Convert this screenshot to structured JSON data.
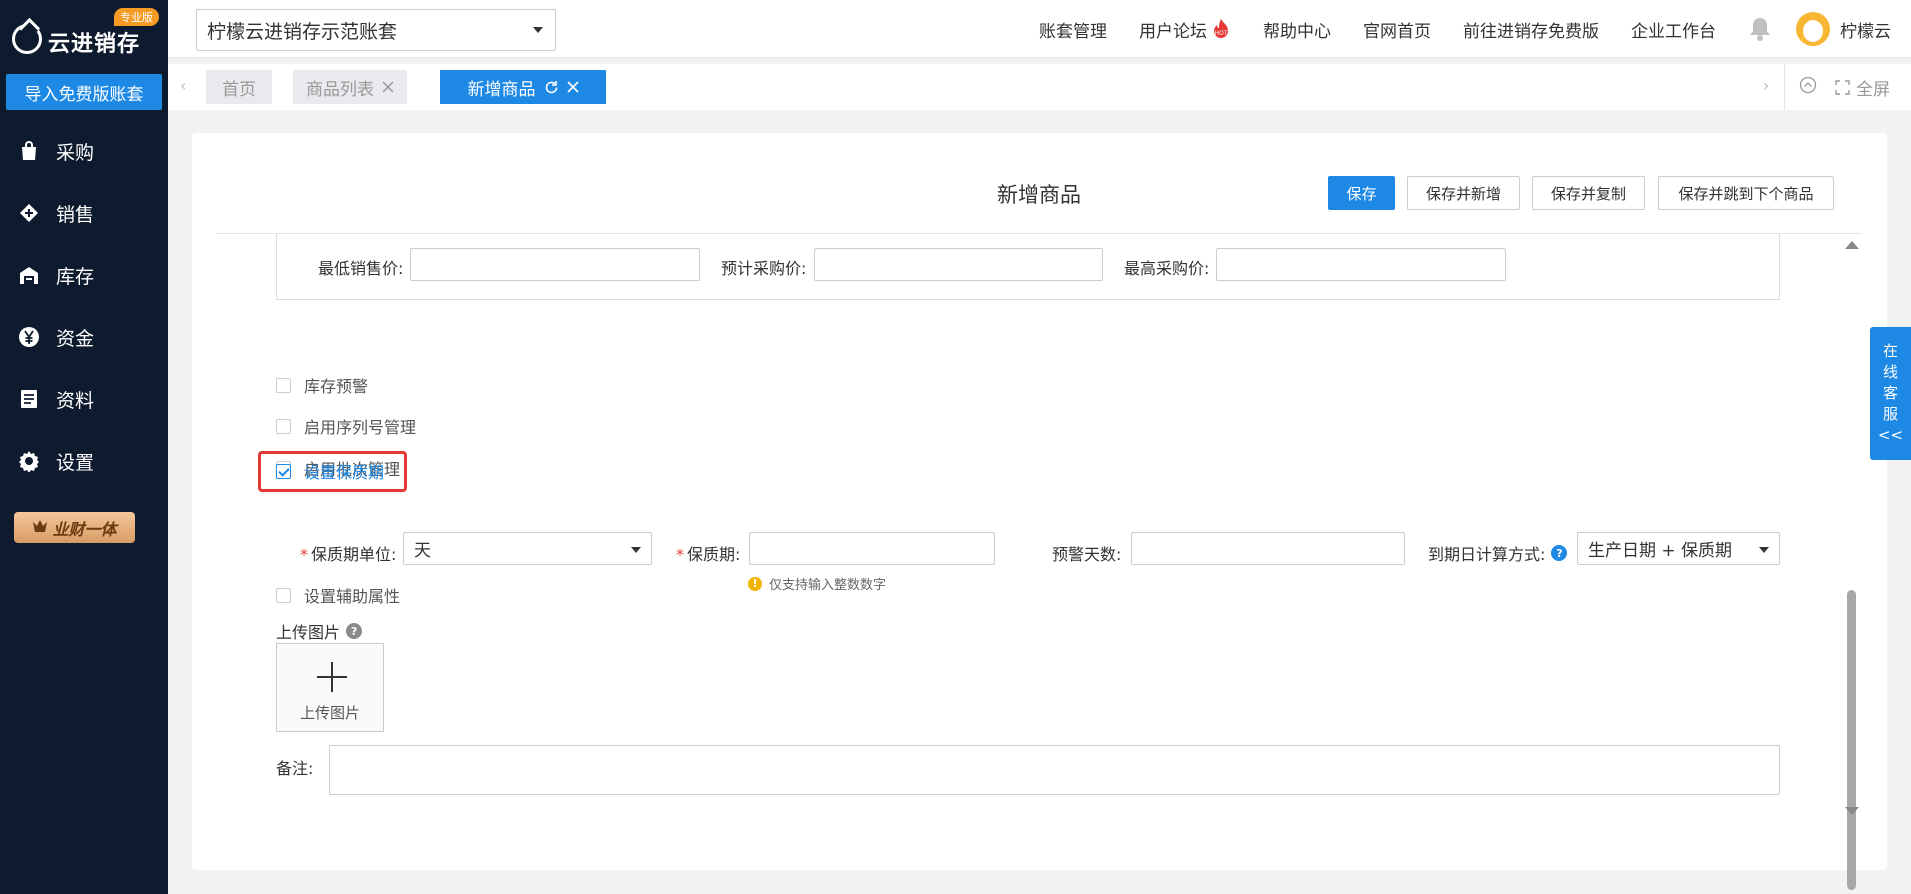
{
  "brand": {
    "name": "云进销存",
    "badge": "专业版"
  },
  "sidebar": {
    "import_button": "导入免费版账套",
    "items": [
      {
        "label": "采购",
        "icon": "shopping-bag-icon"
      },
      {
        "label": "销售",
        "icon": "diamond-icon"
      },
      {
        "label": "库存",
        "icon": "warehouse-icon"
      },
      {
        "label": "资金",
        "icon": "yen-icon"
      },
      {
        "label": "资料",
        "icon": "document-icon"
      },
      {
        "label": "设置",
        "icon": "gear-icon"
      }
    ],
    "vip_badge": "业财一体"
  },
  "header": {
    "account_select": "柠檬云进销存示范账套",
    "links": [
      "账套管理",
      "用户论坛",
      "帮助中心",
      "官网首页",
      "前往进销存免费版",
      "企业工作台"
    ],
    "user_name": "柠檬云"
  },
  "tabs": {
    "items": [
      {
        "label": "首页"
      },
      {
        "label": "商品列表"
      },
      {
        "label": "新增商品"
      }
    ],
    "fullscreen_label": "全屏"
  },
  "page": {
    "title": "新增商品",
    "buttons": {
      "save": "保存",
      "save_new": "保存并新增",
      "save_copy": "保存并复制",
      "save_next": "保存并跳到下个商品"
    }
  },
  "form": {
    "min_sale_price_label": "最低销售价:",
    "est_purchase_price_label": "预计采购价:",
    "max_purchase_price_label": "最高采购价:",
    "checkboxes": [
      {
        "label": "库存预警",
        "checked": false
      },
      {
        "label": "启用序列号管理",
        "checked": false
      },
      {
        "label": "启用批次管理",
        "checked": false
      },
      {
        "label": "设置保质期",
        "checked": true
      },
      {
        "label": "设置辅助属性",
        "checked": false
      }
    ],
    "shelf_life_unit_label": "保质期单位:",
    "shelf_life_unit_value": "天",
    "shelf_life_label": "保质期:",
    "shelf_life_hint": "仅支持输入整数数字",
    "warning_days_label": "预警天数:",
    "expiry_calc_label": "到期日计算方式:",
    "expiry_calc_value": "生产日期 + 保质期",
    "upload_label": "上传图片",
    "upload_box_label": "上传图片",
    "remarks_label": "备注:"
  },
  "service_tab": {
    "chars": [
      "在",
      "线",
      "客",
      "服",
      "<<"
    ]
  },
  "colors": {
    "primary": "#1e88e5",
    "sidebar_bg": "#0e1b2e",
    "highlight": "#e53935"
  }
}
